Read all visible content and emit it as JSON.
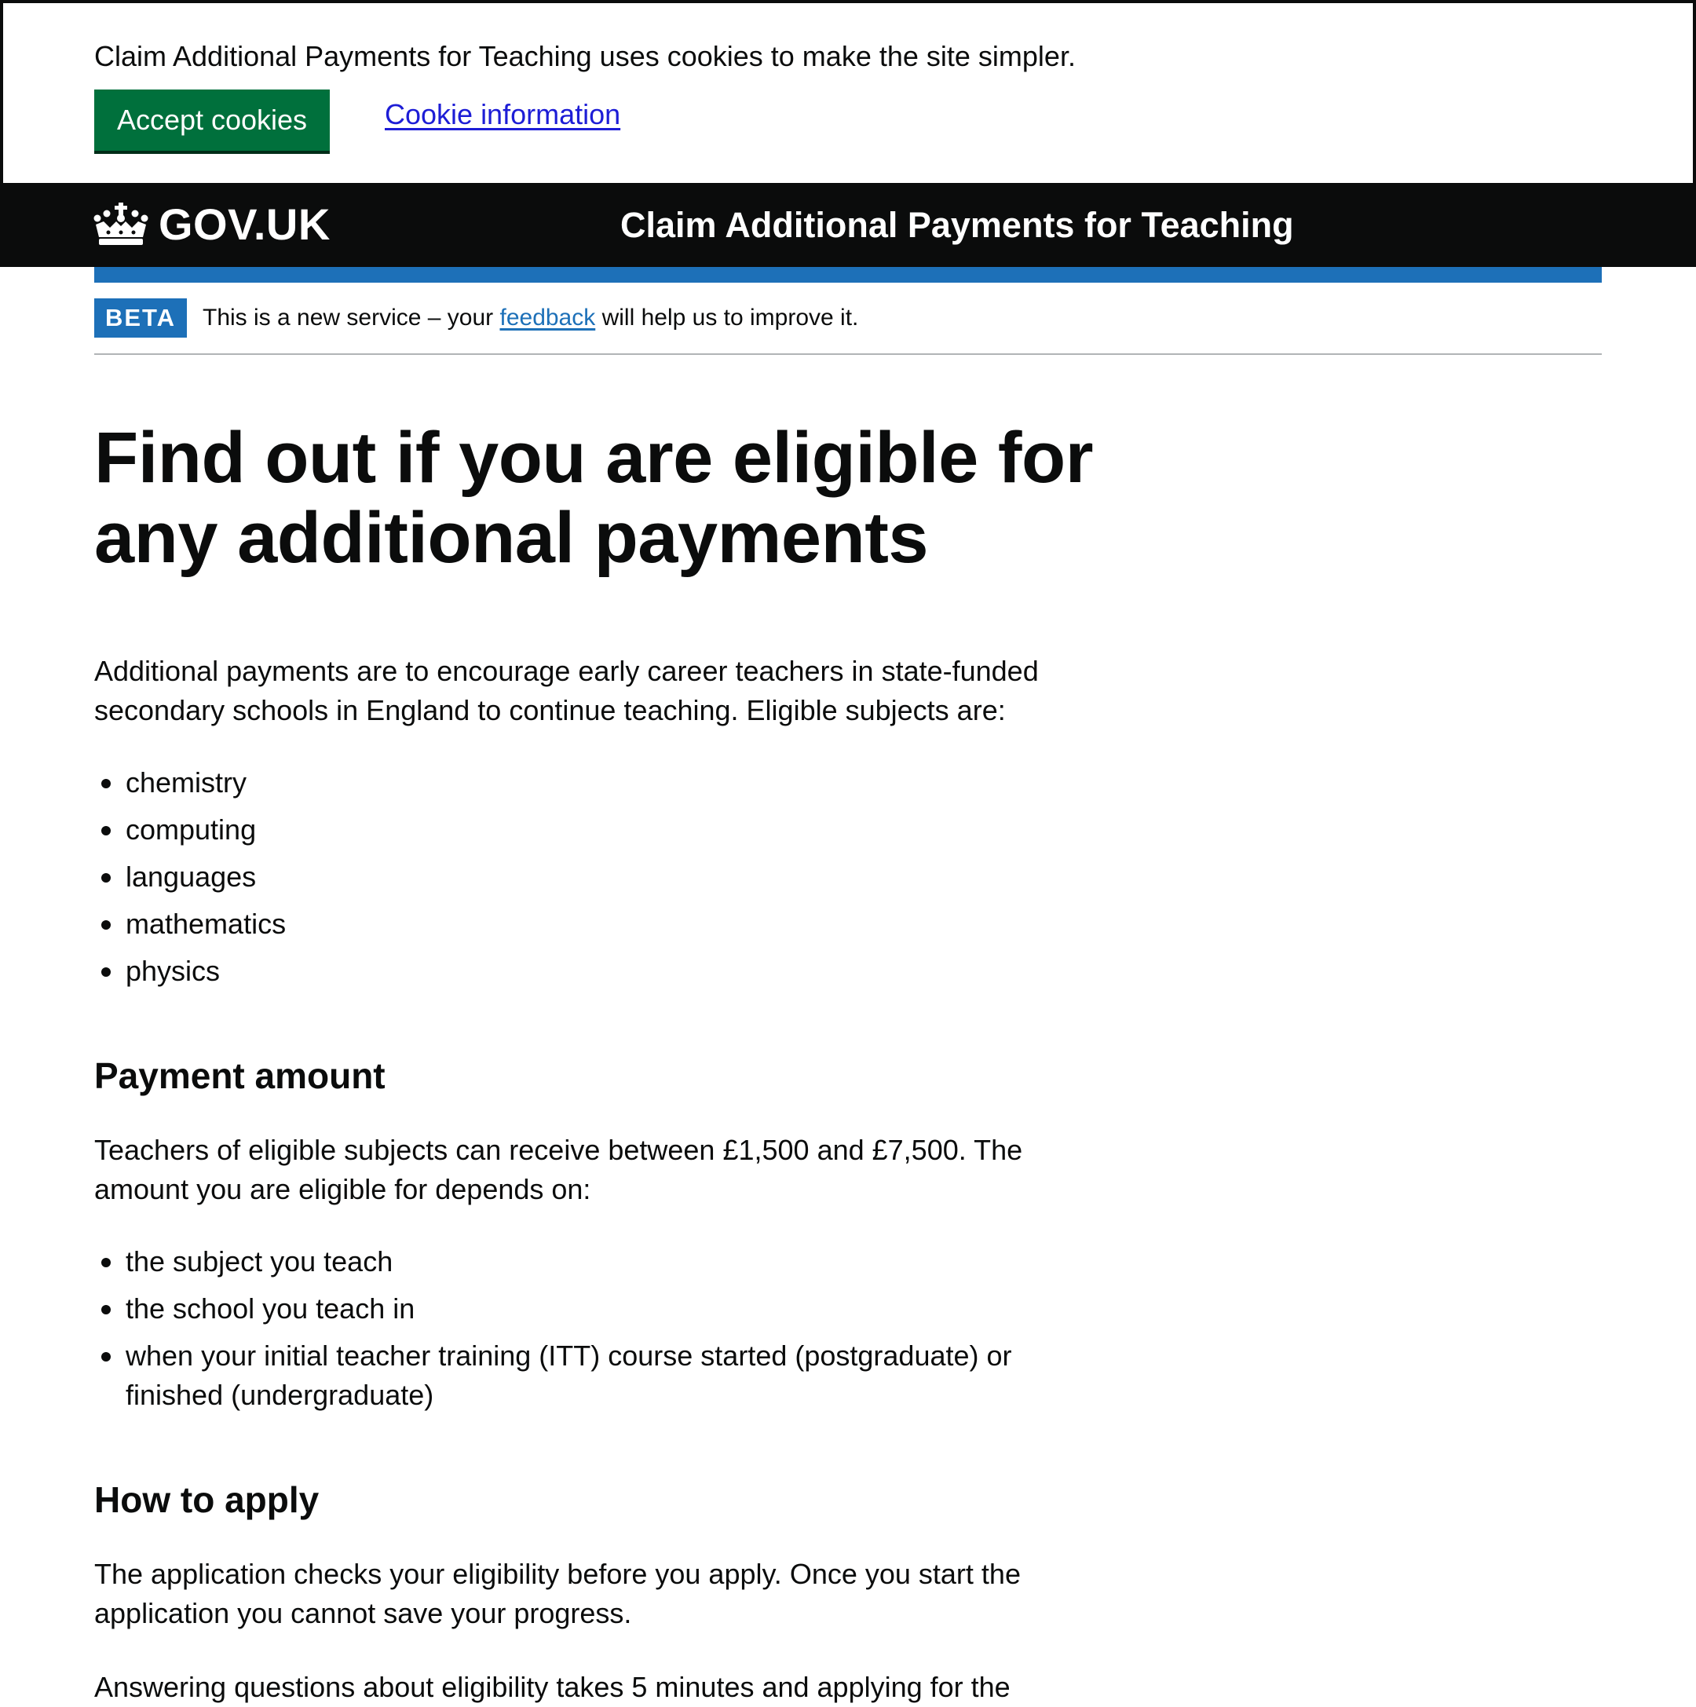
{
  "cookie_banner": {
    "message": "Claim Additional Payments for Teaching uses cookies to make the site simpler.",
    "accept_label": "Accept cookies",
    "info_link": "Cookie information"
  },
  "header": {
    "logo_text": "GOV.UK",
    "logo_icon": "crown-icon",
    "service_name": "Claim Additional Payments for Teaching"
  },
  "phase_banner": {
    "tag": "BETA",
    "text_before": "This is a new service – your ",
    "link": "feedback",
    "text_after": " will help us to improve it."
  },
  "main": {
    "title": "Find out if you are eligible for any additional payments",
    "intro": "Additional payments are to encourage early career teachers in state-funded secondary schools in England to continue teaching. Eligible subjects are:",
    "subjects": [
      "chemistry",
      "computing",
      "languages",
      "mathematics",
      "physics"
    ],
    "payment_heading": "Payment amount",
    "payment_text": "Teachers of eligible subjects can receive between £1,500 and £7,500. The amount you are eligible for depends on:",
    "depends_on": [
      "the subject you teach",
      "the school you teach in",
      "when your initial teacher training (ITT) course started (postgraduate) or finished (undergraduate)"
    ],
    "apply_heading": "How to apply",
    "apply_text": "The application checks your eligibility before you apply. Once you start the application you cannot save your progress.",
    "apply_text_2": "Answering questions about eligibility takes 5 minutes and applying for the"
  },
  "colors": {
    "header_bg": "#0b0c0c",
    "accent_blue": "#1d70b8",
    "button_green": "#00703c",
    "link_blue": "#1d1dd6"
  }
}
